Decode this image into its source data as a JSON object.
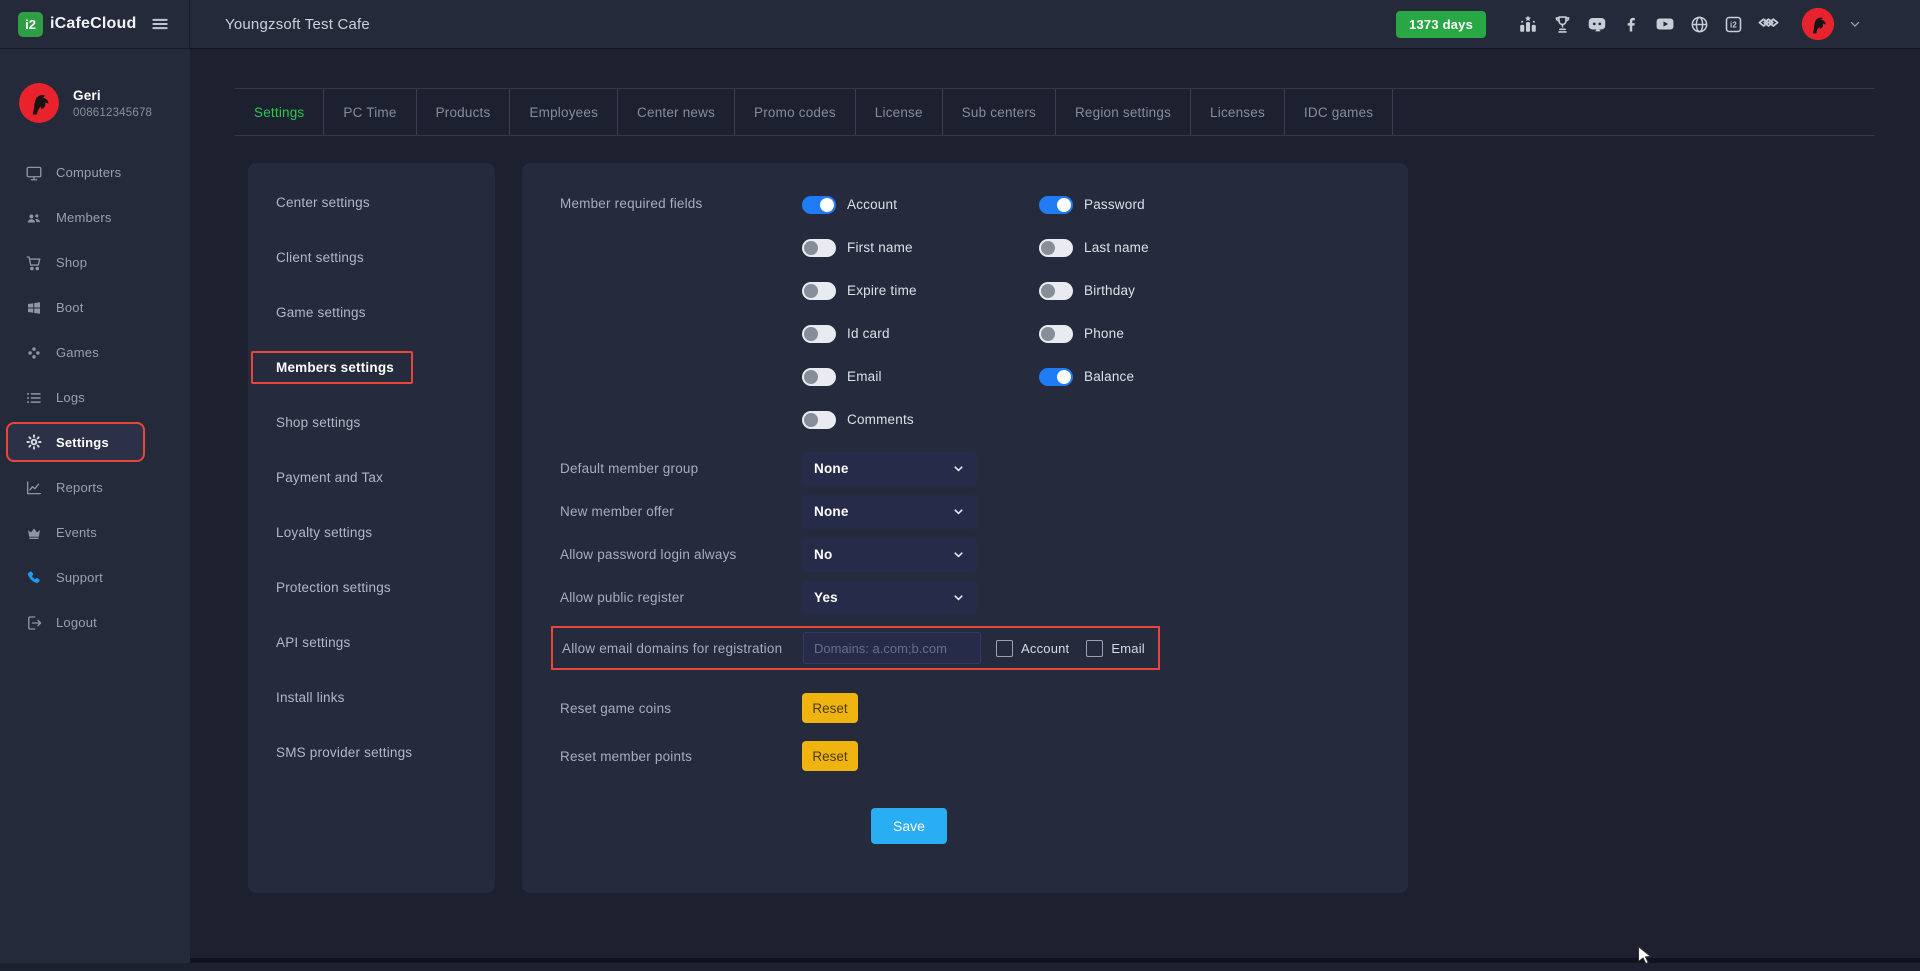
{
  "colors": {
    "topbar_bg": "#252a3b",
    "content_bg": "#1c202f",
    "panel_bg": "#252a3c",
    "accent_green": "#2ec84e",
    "badge_green": "#28a745",
    "toggle_on_blue": "#1f7cf4",
    "save_blue": "#29aef3",
    "reset_amber": "#f0b411",
    "highlight_red": "#e8463c",
    "support_blue": "#1e9bf0",
    "logo_green": "#2f9e44",
    "avatar_red": "#e8232e"
  },
  "topbar": {
    "logo_text": "iCafeCloud",
    "logo_glyph": "i2",
    "title": "Youngzsoft Test Cafe",
    "days_badge": "1373 days",
    "icons": [
      "ranking-icon",
      "trophy-icon",
      "discord-icon",
      "facebook-icon",
      "youtube-icon",
      "globe-icon",
      "icafecloud-icon",
      "layers-icon"
    ],
    "facebook_glyph": "f",
    "icafe_glyph": "i2"
  },
  "user": {
    "name": "Geri",
    "phone": "008612345678"
  },
  "sidebar": {
    "items": [
      {
        "label": "Computers",
        "icon": "monitor-icon",
        "active": false
      },
      {
        "label": "Members",
        "icon": "people-icon",
        "active": false
      },
      {
        "label": "Shop",
        "icon": "cart-icon",
        "active": false
      },
      {
        "label": "Boot",
        "icon": "windows-icon",
        "active": false
      },
      {
        "label": "Games",
        "icon": "gamepad-icon",
        "active": false
      },
      {
        "label": "Logs",
        "icon": "list-icon",
        "active": false
      },
      {
        "label": "Settings",
        "icon": "gear-icon",
        "active": true,
        "highlighted_red_box": true
      },
      {
        "label": "Reports",
        "icon": "chart-icon",
        "active": false
      },
      {
        "label": "Events",
        "icon": "crown-icon",
        "active": false
      },
      {
        "label": "Support",
        "icon": "phone-icon",
        "active": false
      },
      {
        "label": "Logout",
        "icon": "logout-icon",
        "active": false
      }
    ]
  },
  "tabs": {
    "items": [
      {
        "label": "Settings",
        "active": true
      },
      {
        "label": "PC Time",
        "active": false
      },
      {
        "label": "Products",
        "active": false
      },
      {
        "label": "Employees",
        "active": false
      },
      {
        "label": "Center news",
        "active": false
      },
      {
        "label": "Promo codes",
        "active": false
      },
      {
        "label": "License",
        "active": false
      },
      {
        "label": "Sub centers",
        "active": false
      },
      {
        "label": "Region settings",
        "active": false
      },
      {
        "label": "Licenses",
        "active": false
      },
      {
        "label": "IDC games",
        "active": false
      }
    ]
  },
  "settings_menu": {
    "items": [
      {
        "label": "Center settings",
        "selected": false
      },
      {
        "label": "Client settings",
        "selected": false
      },
      {
        "label": "Game settings",
        "selected": false
      },
      {
        "label": "Members settings",
        "selected": true,
        "highlighted_red_box": true
      },
      {
        "label": "Shop settings",
        "selected": false
      },
      {
        "label": "Payment and Tax",
        "selected": false
      },
      {
        "label": "Loyalty settings",
        "selected": false
      },
      {
        "label": "Protection settings",
        "selected": false
      },
      {
        "label": "API settings",
        "selected": false
      },
      {
        "label": "Install links",
        "selected": false
      },
      {
        "label": "SMS provider settings",
        "selected": false
      }
    ]
  },
  "form": {
    "required_fields_label": "Member required fields",
    "toggles": [
      {
        "label": "Account",
        "on": true
      },
      {
        "label": "Password",
        "on": true
      },
      {
        "label": "First name",
        "on": false
      },
      {
        "label": "Last name",
        "on": false
      },
      {
        "label": "Expire time",
        "on": false
      },
      {
        "label": "Birthday",
        "on": false
      },
      {
        "label": "Id card",
        "on": false
      },
      {
        "label": "Phone",
        "on": false
      },
      {
        "label": "Email",
        "on": false
      },
      {
        "label": "Balance",
        "on": true
      },
      {
        "label": "Comments",
        "on": false
      }
    ],
    "selects": [
      {
        "label": "Default member group",
        "value": "None"
      },
      {
        "label": "New member offer",
        "value": "None"
      },
      {
        "label": "Allow password login always",
        "value": "No"
      },
      {
        "label": "Allow public register",
        "value": "Yes"
      }
    ],
    "email_domains": {
      "label": "Allow email domains for registration",
      "placeholder": "Domains: a.com;b.com",
      "value": "",
      "checkboxes": [
        {
          "label": "Account",
          "checked": false
        },
        {
          "label": "Email",
          "checked": false
        }
      ],
      "highlighted_red_box": true
    },
    "resets": [
      {
        "label": "Reset game coins",
        "button": "Reset"
      },
      {
        "label": "Reset member points",
        "button": "Reset"
      }
    ],
    "save_label": "Save"
  }
}
